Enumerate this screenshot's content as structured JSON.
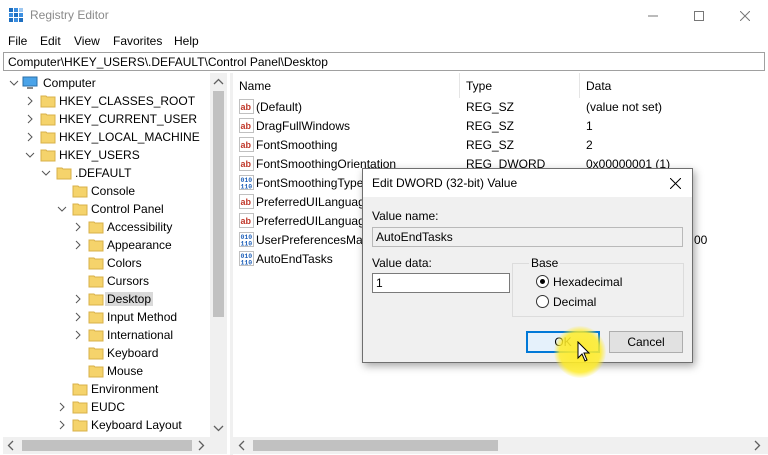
{
  "window": {
    "title": "Registry Editor"
  },
  "menu": [
    "File",
    "Edit",
    "View",
    "Favorites",
    "Help"
  ],
  "address": "Computer\\HKEY_USERS\\.DEFAULT\\Control Panel\\Desktop",
  "tree": [
    {
      "label": "Computer"
    },
    {
      "label": "HKEY_CLASSES_ROOT"
    },
    {
      "label": "HKEY_CURRENT_USER"
    },
    {
      "label": "HKEY_LOCAL_MACHINE"
    },
    {
      "label": "HKEY_USERS"
    },
    {
      "label": ".DEFAULT"
    },
    {
      "label": "Console"
    },
    {
      "label": "Control Panel"
    },
    {
      "label": "Accessibility"
    },
    {
      "label": "Appearance"
    },
    {
      "label": "Colors"
    },
    {
      "label": "Cursors"
    },
    {
      "label": "Desktop"
    },
    {
      "label": "Input Method"
    },
    {
      "label": "International"
    },
    {
      "label": "Keyboard"
    },
    {
      "label": "Mouse"
    },
    {
      "label": "Environment"
    },
    {
      "label": "EUDC"
    },
    {
      "label": "Keyboard Layout"
    }
  ],
  "columns": {
    "name": "Name",
    "type": "Type",
    "data": "Data"
  },
  "values": [
    {
      "icon": "string-value-icon",
      "name": "(Default)",
      "type": "REG_SZ",
      "data": "(value not set)"
    },
    {
      "icon": "string-value-icon",
      "name": "DragFullWindows",
      "type": "REG_SZ",
      "data": "1"
    },
    {
      "icon": "string-value-icon",
      "name": "FontSmoothing",
      "type": "REG_SZ",
      "data": "2"
    },
    {
      "icon": "string-value-icon",
      "name": "FontSmoothingOrientation",
      "type": "REG_DWORD",
      "data": "0x00000001 (1)"
    },
    {
      "icon": "binary-value-icon",
      "name": "FontSmoothingType",
      "type": "",
      "data": ""
    },
    {
      "icon": "string-value-icon",
      "name": "PreferredUILanguag",
      "type": "",
      "data": ""
    },
    {
      "icon": "string-value-icon",
      "name": "PreferredUILanguag",
      "type": "",
      "data": ""
    },
    {
      "icon": "binary-value-icon",
      "name": "UserPreferencesMas",
      "type": "",
      "data": "00"
    },
    {
      "icon": "binary-value-icon",
      "name": "AutoEndTasks",
      "type": "",
      "data": ""
    }
  ],
  "dialog": {
    "title": "Edit DWORD (32-bit) Value",
    "value_name_label": "Value name:",
    "value_name": "AutoEndTasks",
    "value_data_label": "Value data:",
    "value_data": "1",
    "base_label": "Base",
    "hex_label": "Hexadecimal",
    "dec_label": "Decimal",
    "selected_base": "Hexadecimal",
    "ok_label": "OK",
    "cancel_label": "Cancel"
  },
  "colors": {
    "folder": "#f5d36b",
    "accent": "#0078d7",
    "highlight": "#ffec28"
  }
}
